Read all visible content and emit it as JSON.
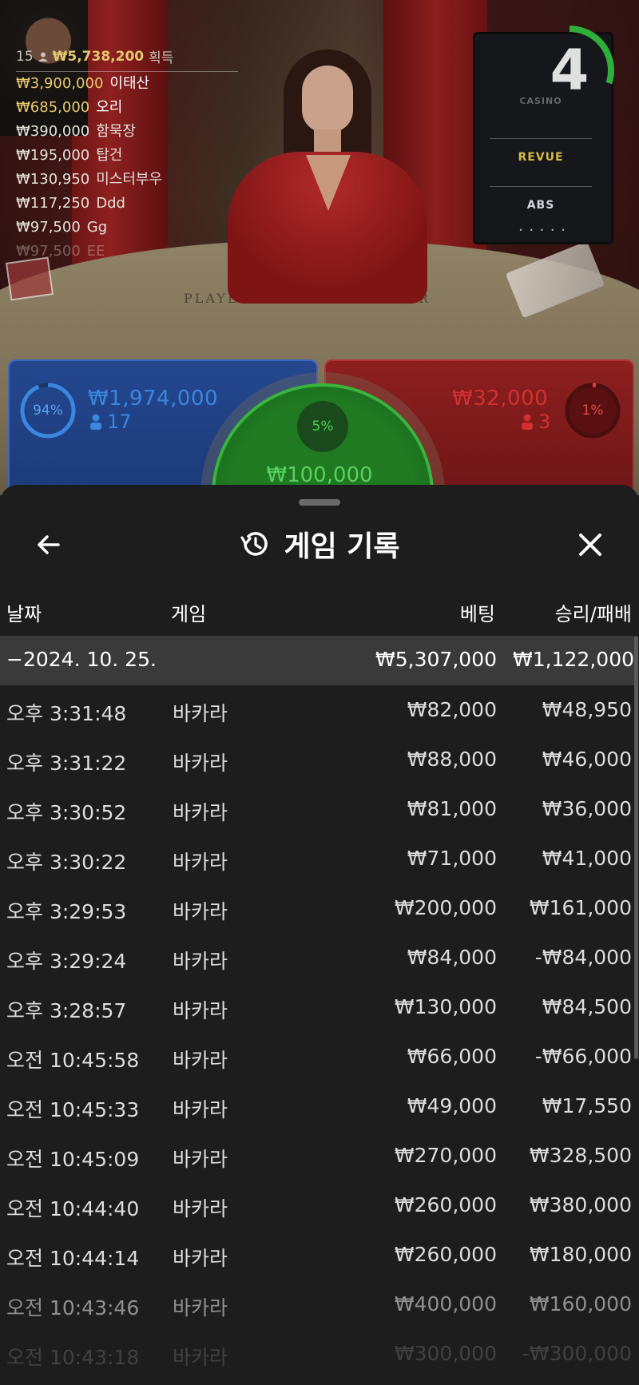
{
  "live": {
    "table_labels": {
      "player": "PLAYER",
      "banker": "BANKER"
    },
    "winners": {
      "count": "15",
      "total": "₩5,738,200",
      "suffix": "획득",
      "list": [
        {
          "amount": "₩3,900,000",
          "name": "이태산"
        },
        {
          "amount": "₩685,000",
          "name": "오리"
        },
        {
          "amount": "₩390,000",
          "name": "함묵장"
        },
        {
          "amount": "₩195,000",
          "name": "탑건"
        },
        {
          "amount": "₩130,950",
          "name": "미스터부우"
        },
        {
          "amount": "₩117,250",
          "name": "Ddd"
        },
        {
          "amount": "₩97,500",
          "name": "Gg"
        },
        {
          "amount": "₩97,500",
          "name": "EE"
        }
      ]
    },
    "timer": {
      "value": "4",
      "progress": 0.3
    },
    "sponsors": {
      "logo1": "CASINO",
      "logo2": "REVUE",
      "logo3": "ABS",
      "dots": "• • • • •"
    },
    "player": {
      "percent": "94%",
      "percent_value": 0.94,
      "amount": "₩1,974,000",
      "count": "17"
    },
    "banker": {
      "percent": "1%",
      "percent_value": 0.01,
      "amount": "₩32,000",
      "count": "3"
    },
    "tie": {
      "percent": "5%",
      "amount": "₩100,000"
    },
    "colors": {
      "player": "#3b86e0",
      "banker": "#c82a2a",
      "tie": "#3ab43e",
      "gold": "#e8c970"
    }
  },
  "sheet": {
    "title": "게임 기록",
    "icons": {
      "back": "arrow-left-icon",
      "history": "history-icon",
      "close": "close-icon"
    },
    "columns": {
      "date": "날짜",
      "game": "게임",
      "bet": "베팅",
      "result": "승리/패배"
    },
    "date_group": {
      "date": "−2024. 10. 25.",
      "bet_total": "₩5,307,000",
      "result_total": "₩1,122,000"
    },
    "rows": [
      {
        "time": "오후 3:31:48",
        "game": "바카라",
        "bet": "₩82,000",
        "result": "₩48,950"
      },
      {
        "time": "오후 3:31:22",
        "game": "바카라",
        "bet": "₩88,000",
        "result": "₩46,000"
      },
      {
        "time": "오후 3:30:52",
        "game": "바카라",
        "bet": "₩81,000",
        "result": "₩36,000"
      },
      {
        "time": "오후 3:30:22",
        "game": "바카라",
        "bet": "₩71,000",
        "result": "₩41,000"
      },
      {
        "time": "오후 3:29:53",
        "game": "바카라",
        "bet": "₩200,000",
        "result": "₩161,000"
      },
      {
        "time": "오후 3:29:24",
        "game": "바카라",
        "bet": "₩84,000",
        "result": "-₩84,000"
      },
      {
        "time": "오후 3:28:57",
        "game": "바카라",
        "bet": "₩130,000",
        "result": "₩84,500"
      },
      {
        "time": "오전 10:45:58",
        "game": "바카라",
        "bet": "₩66,000",
        "result": "-₩66,000"
      },
      {
        "time": "오전 10:45:33",
        "game": "바카라",
        "bet": "₩49,000",
        "result": "₩17,550"
      },
      {
        "time": "오전 10:45:09",
        "game": "바카라",
        "bet": "₩270,000",
        "result": "₩328,500"
      },
      {
        "time": "오전 10:44:40",
        "game": "바카라",
        "bet": "₩260,000",
        "result": "₩380,000"
      },
      {
        "time": "오전 10:44:14",
        "game": "바카라",
        "bet": "₩260,000",
        "result": "₩180,000"
      },
      {
        "time": "오전 10:43:46",
        "game": "바카라",
        "bet": "₩400,000",
        "result": "₩160,000"
      },
      {
        "time": "오전 10:43:18",
        "game": "바카라",
        "bet": "₩300,000",
        "result": "-₩300,000"
      }
    ]
  }
}
